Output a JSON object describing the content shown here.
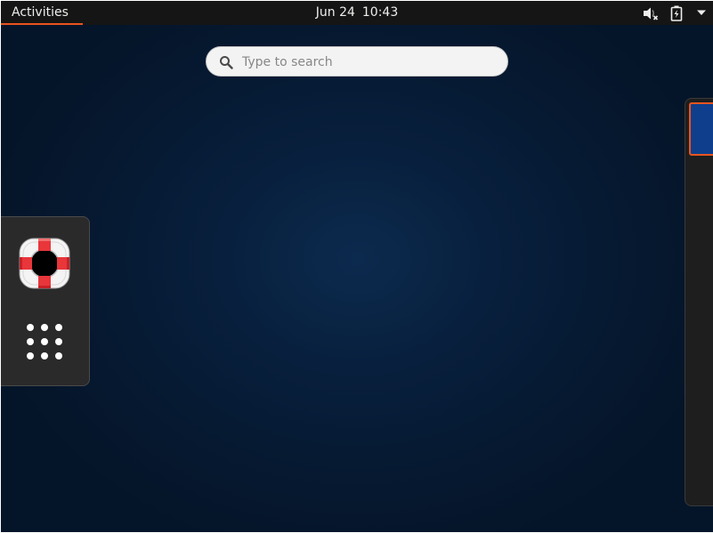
{
  "top_bar": {
    "activities_label": "Activities",
    "date": "Jun 24",
    "time": "10:43",
    "icons": [
      "volume-muted-icon",
      "battery-charging-icon",
      "dropdown-arrow-icon"
    ]
  },
  "search": {
    "placeholder": "Type to search",
    "value": "",
    "icon": "search-icon"
  },
  "dash": {
    "items": [
      {
        "name": "help",
        "icon": "lifebuoy-icon"
      },
      {
        "name": "show-applications",
        "icon": "app-grid-icon"
      }
    ]
  },
  "workspaces": {
    "count_visible": 1,
    "active_index": 0
  },
  "colors": {
    "accent": "#e95420",
    "panel": "#151515",
    "background": "#061a33",
    "workspace_thumb": "#0f3f8c"
  }
}
